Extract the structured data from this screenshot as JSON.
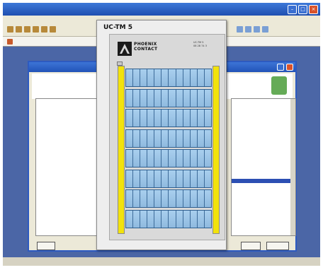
{
  "popup": {
    "title": "UC-TM 5"
  },
  "device": {
    "brand_line1": "PHOENIX",
    "brand_line2": "CONTACT",
    "id_line1": "UC-TM 5",
    "id_line2": "08 28 74 3"
  },
  "rows": [
    {
      "cells": 12
    },
    {
      "cells": 12
    },
    {
      "cells": 12
    },
    {
      "cells": 12
    },
    {
      "cells": 12
    },
    {
      "cells": 12
    },
    {
      "cells": 12
    },
    {
      "cells": 12
    }
  ],
  "colors": {
    "rail": "#f2e20c",
    "cell": "#9ec6e8",
    "desktop": "#4b66a6",
    "titlebar": "#2253b8"
  },
  "icons": [
    "minimize-icon",
    "maximize-icon",
    "close-icon",
    "help-icon",
    "app-icon"
  ]
}
